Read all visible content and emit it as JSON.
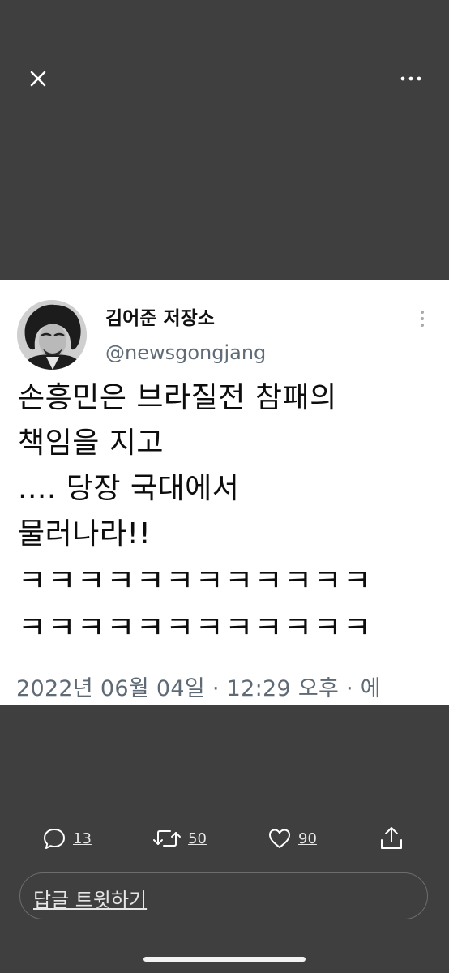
{
  "viewer": {
    "close_icon": "close-icon",
    "more_icon": "more-horizontal-icon"
  },
  "tweet": {
    "display_name": "김어준 저장소",
    "handle": "@newsgongjang",
    "text_lines": [
      "손흥민은 브라질전 참패의",
      "책임을 지고",
      ".... 당장 국대에서",
      "물러나라!!"
    ],
    "laugh_lines": [
      "ㅋㅋㅋㅋㅋㅋㅋㅋㅋㅋㅋㅋ",
      "ㅋㅋㅋㅋㅋㅋㅋㅋㅋㅋㅋㅋ"
    ],
    "meta": "2022년 06월 04일 · 12:29 오후 · 에"
  },
  "actions": {
    "reply_count": "13",
    "retweet_count": "50",
    "like_count": "90"
  },
  "reply_box": {
    "placeholder": "답글 트윗하기"
  },
  "colors": {
    "background": "#3f3f3f",
    "icon": "#ffffff",
    "meta_text": "#5e6a75"
  }
}
